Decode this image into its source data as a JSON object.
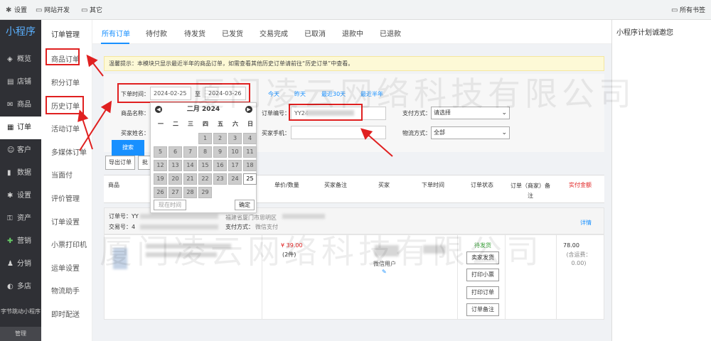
{
  "bookmarks": {
    "items": [
      {
        "icon": "gear-icon",
        "label": "设置"
      },
      {
        "icon": "folder-icon",
        "label": "网站开发"
      },
      {
        "icon": "folder-icon",
        "label": "其它"
      }
    ],
    "all_label": "所有书签"
  },
  "sidebar": {
    "logo": "小程序",
    "items": [
      {
        "icon": "layers-icon",
        "label": "概览"
      },
      {
        "icon": "store-icon",
        "label": "店铺"
      },
      {
        "icon": "product-icon",
        "label": "商品"
      },
      {
        "icon": "order-icon",
        "label": "订单"
      },
      {
        "icon": "customer-icon",
        "label": "客户"
      },
      {
        "icon": "chart-icon",
        "label": "数据"
      },
      {
        "icon": "gear-icon",
        "label": "设置"
      },
      {
        "icon": "asset-icon",
        "label": "资产"
      },
      {
        "icon": "marketing-icon",
        "label": "营销"
      },
      {
        "icon": "distribution-icon",
        "label": "分销"
      },
      {
        "icon": "store-icon",
        "label": "多店"
      }
    ],
    "tt_label": "字节跳动小程序",
    "manage": "管理"
  },
  "submenu": {
    "title": "订单管理",
    "items": [
      "商品订单",
      "积分订单",
      "历史订单",
      "活动订单",
      "多媒体订单",
      "当面付",
      "评价管理",
      "订单设置",
      "小票打印机",
      "运单设置",
      "物流助手",
      "即时配送"
    ]
  },
  "tabs": [
    "所有订单",
    "待付款",
    "待发货",
    "已发货",
    "交易完成",
    "已取消",
    "退款中",
    "已退款"
  ],
  "right_pane": {
    "title": "小程序计划诚邀您"
  },
  "notice": "温馨提示：本模块只显示最近半年的商品订单，如需查看其他历史订单请前往“历史订单”中查看。",
  "filters": {
    "order_time_label": "下单时间：",
    "start_date": "2024-02-25",
    "to_label": "至",
    "end_date": "2024-03-26",
    "quick": [
      "今天",
      "昨天",
      "最近30天",
      "最近半年"
    ],
    "product_name_label": "商品名称：",
    "buyer_name_label": "买家姓名：",
    "order_no_label": "订单编号：",
    "order_no_value": "YY24",
    "pay_method_label": "支付方式：",
    "pay_method_value": "请选择",
    "buyer_phone_label": "买家手机：",
    "logistics_label": "物流方式：",
    "logistics_value": "全部",
    "search_btn": "搜索",
    "export_btn": "导出订单",
    "batch_btn": "批"
  },
  "calendar": {
    "month_title": "二月 2024",
    "weekdays": [
      "一",
      "二",
      "三",
      "四",
      "五",
      "六",
      "日"
    ],
    "days": [
      [
        "",
        "",
        "",
        "1",
        "2",
        "3",
        "4"
      ],
      [
        "5",
        "6",
        "7",
        "8",
        "9",
        "10",
        "11"
      ],
      [
        "12",
        "13",
        "14",
        "15",
        "16",
        "17",
        "18"
      ],
      [
        "19",
        "20",
        "21",
        "22",
        "23",
        "24",
        "25"
      ],
      [
        "26",
        "27",
        "28",
        "29",
        "",
        "",
        ""
      ]
    ],
    "selected_day": "25",
    "now_btn": "现在时间",
    "ok_btn": "确定"
  },
  "table": {
    "headers": [
      "商品",
      "单价/数量",
      "买家备注",
      "买家",
      "下单时间",
      "订单状态",
      "订单（商家）备注",
      "实付金额"
    ]
  },
  "order": {
    "order_no_label": "订单号：YY",
    "trade_no_label": "交易号：4",
    "address": "福建省厦门市思明区",
    "pay_method_label": "支付方式：",
    "pay_method": "微信支付",
    "detail": "详情",
    "price": "¥ 39.00",
    "qty": "(2件)",
    "buyer": "微信用户",
    "status": "待发货",
    "actions": [
      "卖家发货",
      "打印小票",
      "打印订单",
      "订单备注"
    ],
    "total": "78.00",
    "shipping": "(含运费：0.00)"
  },
  "watermark": "厦门凌云网络科技有限公司",
  "colors": {
    "accent": "#1890ff",
    "highlight": "#e02020",
    "sidebar_bg": "#2f3035"
  }
}
